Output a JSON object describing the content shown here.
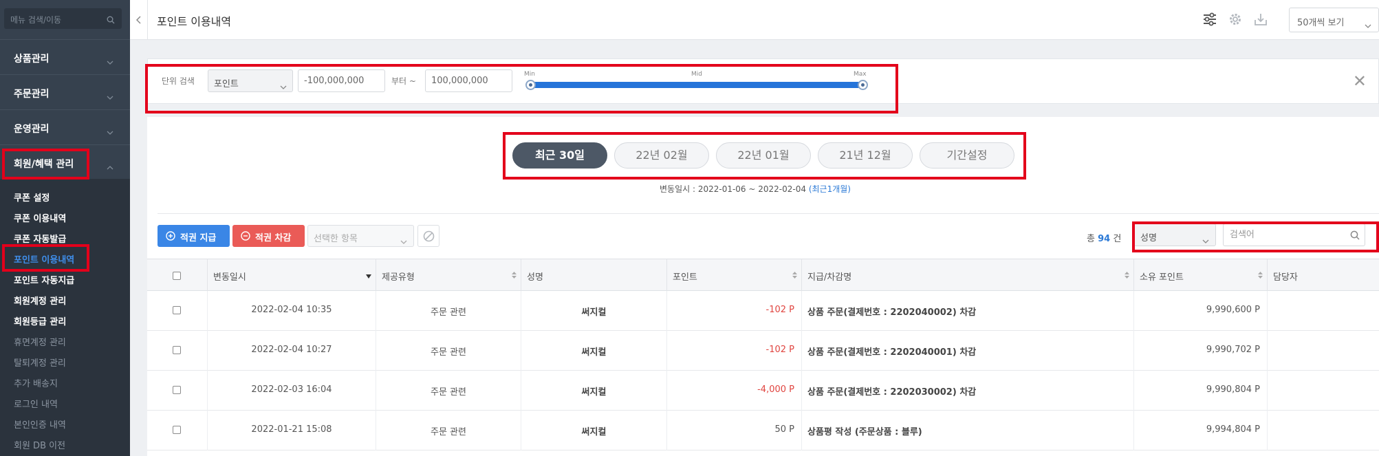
{
  "sidebar": {
    "search_placeholder": "메뉴 검색/이동",
    "sections": [
      {
        "label": "상품관리"
      },
      {
        "label": "주문관리"
      },
      {
        "label": "운영관리"
      },
      {
        "label": "회원/혜택 관리"
      }
    ],
    "submenu": [
      {
        "label": "쿠폰 설정",
        "state": "normal"
      },
      {
        "label": "쿠폰 이용내역",
        "state": "normal"
      },
      {
        "label": "쿠폰 자동발급",
        "state": "normal"
      },
      {
        "label": "포인트 이용내역",
        "state": "active"
      },
      {
        "label": "포인트 자동지급",
        "state": "normal"
      },
      {
        "label": "회원계정 관리",
        "state": "normal"
      },
      {
        "label": "회원등급 관리",
        "state": "normal"
      },
      {
        "label": "휴면계정 관리",
        "state": "dim"
      },
      {
        "label": "탈퇴계정 관리",
        "state": "dim"
      },
      {
        "label": "추가 배송지",
        "state": "dim"
      },
      {
        "label": "로그인 내역",
        "state": "dim"
      },
      {
        "label": "본인인증 내역",
        "state": "dim"
      },
      {
        "label": "회원 DB 이전",
        "state": "dim"
      }
    ]
  },
  "header": {
    "title": "포인트 이용내역",
    "view_option": "50개씩 보기"
  },
  "filter": {
    "unit_label": "단위 검색",
    "unit_value": "포인트",
    "min_value": "-100,000,000",
    "from_label": "부터 ~",
    "max_value": "100,000,000",
    "slider_min": "Min",
    "slider_mid": "Mid",
    "slider_max": "Max",
    "close_symbol": "✕"
  },
  "period": {
    "buttons": [
      {
        "label": "최근 30일",
        "active": true
      },
      {
        "label": "22년 02월",
        "active": false
      },
      {
        "label": "22년 01월",
        "active": false
      },
      {
        "label": "21년 12월",
        "active": false
      },
      {
        "label": "기간설정",
        "active": false
      }
    ],
    "range_text": "변동일시 : 2022-01-06 ~ 2022-02-04",
    "range_link": "(최근1개월)"
  },
  "toolbar": {
    "grant_label": "적권 지급",
    "deduct_label": "적권 차감",
    "selected_placeholder": "선택한 항목",
    "total_prefix": "총",
    "total_count": "94",
    "total_suffix": "건",
    "search_field": "성명",
    "search_placeholder": "검색어"
  },
  "table": {
    "columns": [
      "변동일시",
      "제공유형",
      "성명",
      "포인트",
      "지급/차감명",
      "소유 포인트",
      "담당자"
    ],
    "rows": [
      {
        "date": "2022-02-04 10:35",
        "type": "주문 관련",
        "name": "써지컬",
        "point": "-102 P",
        "negative": true,
        "desc": "상품 주문(결제번호 : 2202040002) 차감",
        "balance": "9,990,600 P",
        "manager": ""
      },
      {
        "date": "2022-02-04 10:27",
        "type": "주문 관련",
        "name": "써지컬",
        "point": "-102 P",
        "negative": true,
        "desc": "상품 주문(결제번호 : 2202040001) 차감",
        "balance": "9,990,702 P",
        "manager": ""
      },
      {
        "date": "2022-02-03 16:04",
        "type": "주문 관련",
        "name": "써지컬",
        "point": "-4,000 P",
        "negative": true,
        "desc": "상품 주문(결제번호 : 2202030002) 차감",
        "balance": "9,990,804 P",
        "manager": ""
      },
      {
        "date": "2022-01-21 15:08",
        "type": "주문 관련",
        "name": "써지컬",
        "point": "50 P",
        "negative": false,
        "desc": "상품평 작성 (주문상품 : 블루)",
        "balance": "9,994,804 P",
        "manager": ""
      }
    ]
  },
  "colors": {
    "sidebar_bg": "#36414e",
    "accent_blue": "#2c7ad6",
    "grant_btn": "#3a86e6",
    "deduct_btn": "#ea5b57",
    "negative": "#e0443f",
    "annotation_red": "#e3001b"
  }
}
